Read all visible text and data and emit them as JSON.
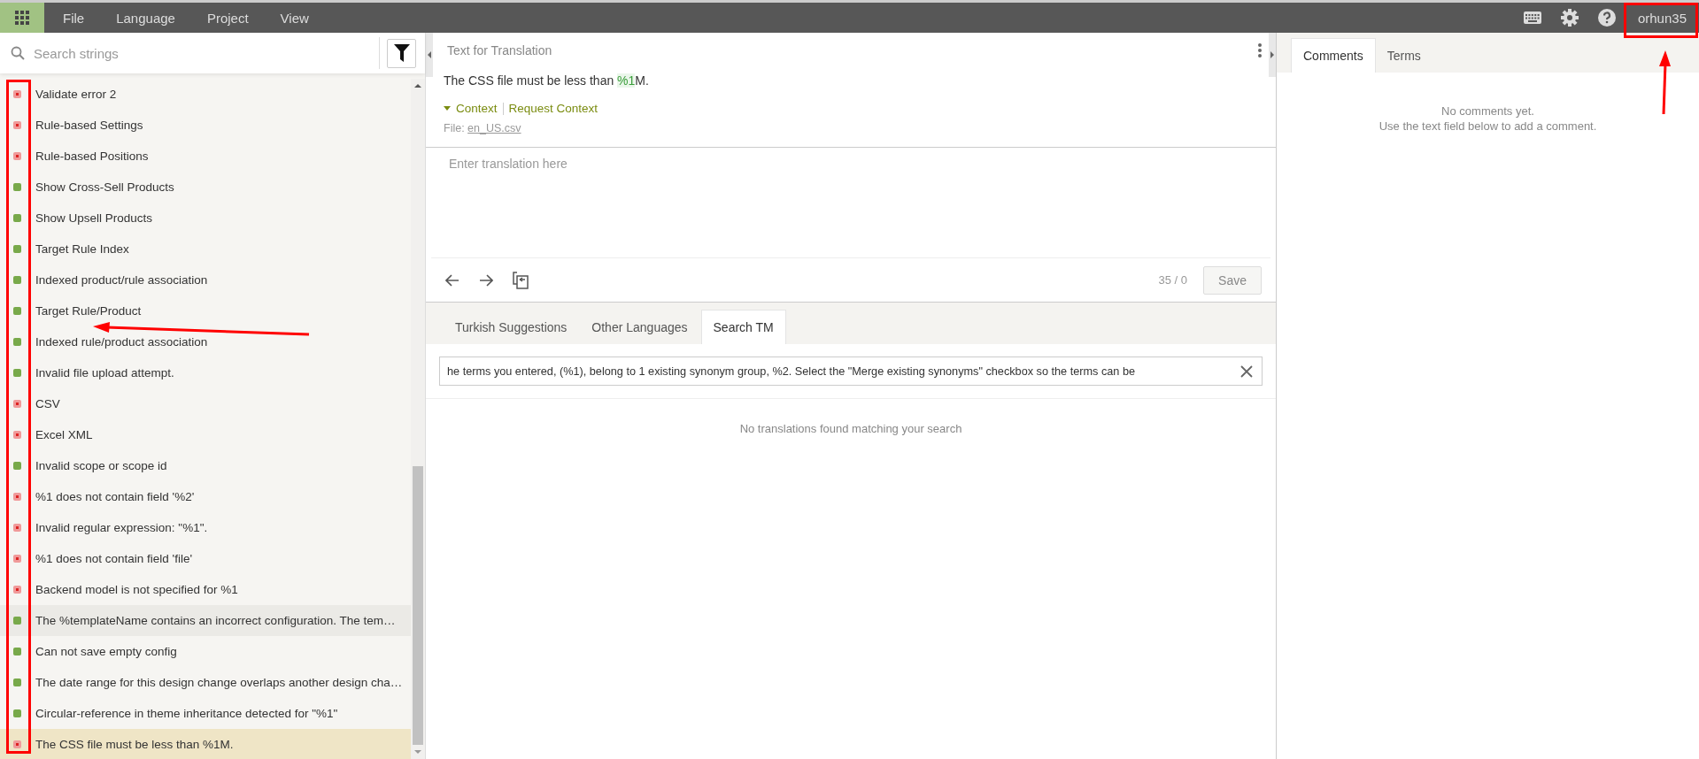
{
  "menu": [
    "File",
    "Language",
    "Project",
    "View"
  ],
  "user": {
    "name": "orhun35"
  },
  "search": {
    "placeholder": "Search strings"
  },
  "strings": [
    {
      "text": "Validate error 2",
      "translated": false,
      "hovered": false,
      "selected": false
    },
    {
      "text": "Rule-based Settings",
      "translated": false,
      "hovered": false,
      "selected": false
    },
    {
      "text": "Rule-based Positions",
      "translated": false,
      "hovered": false,
      "selected": false
    },
    {
      "text": "Show Cross-Sell Products",
      "translated": true,
      "hovered": false,
      "selected": false
    },
    {
      "text": "Show Upsell Products",
      "translated": true,
      "hovered": false,
      "selected": false
    },
    {
      "text": "Target Rule Index",
      "translated": true,
      "hovered": false,
      "selected": false
    },
    {
      "text": "Indexed product/rule association",
      "translated": true,
      "hovered": false,
      "selected": false
    },
    {
      "text": "Target Rule/Product",
      "translated": true,
      "hovered": false,
      "selected": false
    },
    {
      "text": "Indexed rule/product association",
      "translated": true,
      "hovered": false,
      "selected": false
    },
    {
      "text": "Invalid file upload attempt.",
      "translated": true,
      "hovered": false,
      "selected": false
    },
    {
      "text": "CSV",
      "translated": false,
      "hovered": false,
      "selected": false
    },
    {
      "text": "Excel XML",
      "translated": false,
      "hovered": false,
      "selected": false
    },
    {
      "text": "Invalid scope or scope id",
      "translated": true,
      "hovered": false,
      "selected": false
    },
    {
      "text": "%1 does not contain field '%2'",
      "translated": false,
      "hovered": false,
      "selected": false
    },
    {
      "text": "Invalid regular expression: \"%1\".",
      "translated": false,
      "hovered": false,
      "selected": false
    },
    {
      "text": "%1 does not contain field 'file'",
      "translated": false,
      "hovered": false,
      "selected": false
    },
    {
      "text": "Backend model is not specified for %1",
      "translated": false,
      "hovered": false,
      "selected": false
    },
    {
      "text": "The %templateName contains an incorrect configuration. The tem…",
      "translated": true,
      "hovered": true,
      "selected": false
    },
    {
      "text": "Can not save empty config",
      "translated": true,
      "hovered": false,
      "selected": false
    },
    {
      "text": "The date range for this design change overlaps another design cha…",
      "translated": true,
      "hovered": false,
      "selected": false
    },
    {
      "text": "Circular-reference in theme inheritance detected for \"%1\"",
      "translated": true,
      "hovered": false,
      "selected": false
    },
    {
      "text": "The CSS file must be less than %1M.",
      "translated": false,
      "hovered": false,
      "selected": true
    }
  ],
  "source": {
    "heading": "Text for Translation",
    "text": "The CSS file must be less than **%1**M.",
    "context_link": "Context",
    "request_link": "Request Context",
    "file_label": "File:",
    "file_name": "en_US.csv"
  },
  "translation": {
    "placeholder": "Enter translation here",
    "counter": "35 / 0",
    "save": "Save"
  },
  "suggestion_tabs": [
    {
      "label": "Turkish Suggestions",
      "selected": false
    },
    {
      "label": "Other Languages",
      "selected": false
    },
    {
      "label": "Search TM",
      "selected": true
    }
  ],
  "tm_search": {
    "value": "he terms you entered, (%1), belong to 1 existing synonym group, %2. Select the \"Merge existing synonyms\" checkbox so the terms can be",
    "empty": "No translations found matching your search"
  },
  "side_tabs": [
    {
      "label": "Comments",
      "selected": true
    },
    {
      "label": "Terms",
      "selected": false
    }
  ],
  "comments": {
    "empty_title": "No comments yet.",
    "empty_hint": "Use the text field below to add a comment."
  }
}
